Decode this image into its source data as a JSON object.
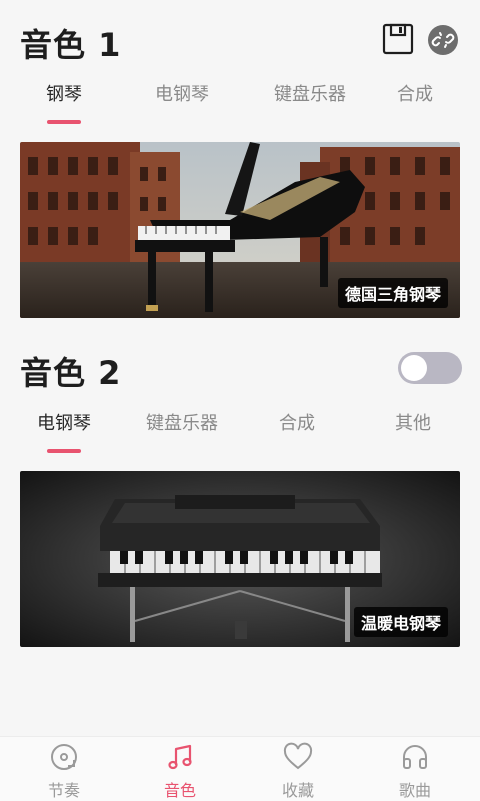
{
  "section1": {
    "title": "音色 1",
    "tabs": [
      {
        "label": "钢琴",
        "active": true
      },
      {
        "label": "电钢琴",
        "active": false
      },
      {
        "label": "键盘乐器",
        "active": false
      },
      {
        "label": "合成",
        "active": false
      }
    ],
    "banner_label": "德国三角钢琴"
  },
  "section2": {
    "title": "音色 2",
    "toggle_on": false,
    "tabs": [
      {
        "label": "电钢琴",
        "active": true
      },
      {
        "label": "键盘乐器",
        "active": false
      },
      {
        "label": "合成",
        "active": false
      },
      {
        "label": "其他",
        "active": false
      }
    ],
    "banner_label": "温暖电钢琴"
  },
  "header_icons": {
    "save": "save-icon",
    "link": "unlink-icon"
  },
  "bottom_nav": [
    {
      "label": "节奏",
      "icon": "metronome-disc-icon",
      "active": false
    },
    {
      "label": "音色",
      "icon": "music-note-icon",
      "active": true
    },
    {
      "label": "收藏",
      "icon": "heart-icon",
      "active": false
    },
    {
      "label": "歌曲",
      "icon": "headphones-icon",
      "active": false
    }
  ],
  "colors": {
    "accent": "#e8536f",
    "inactive": "#9a9a9a",
    "toggle_off": "#b9b7c3"
  }
}
